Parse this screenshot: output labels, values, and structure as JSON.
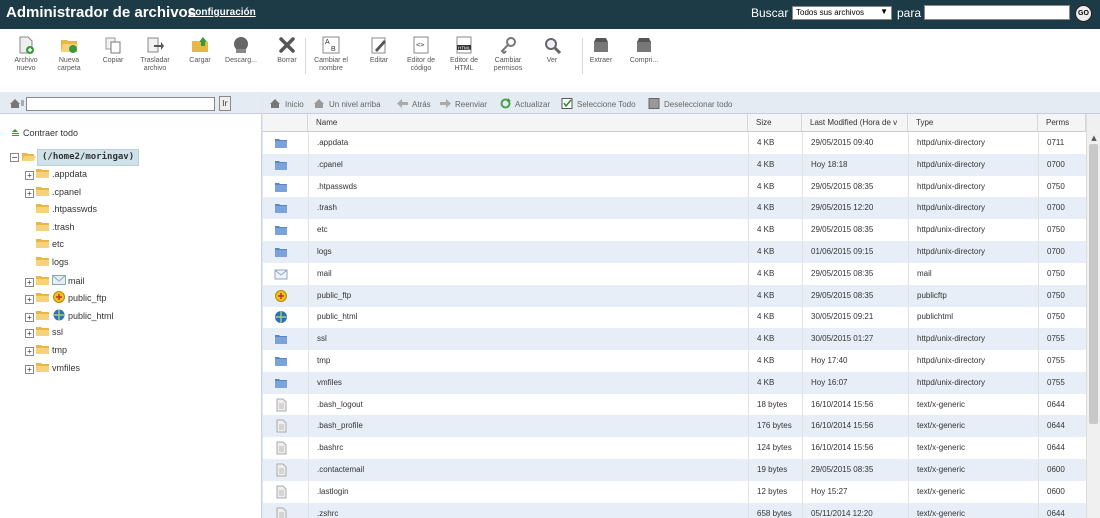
{
  "header": {
    "title": "Administrador de archivos",
    "config_link": "Configuración",
    "search_label": "Buscar",
    "search_scope": "Todos sus archivos",
    "para_label": "para",
    "search_value": "",
    "go_label": "GO"
  },
  "toolbar": {
    "items": [
      {
        "label": "Archivo nuevo",
        "icon": "new-file-icon"
      },
      {
        "label": "Nueva carpeta",
        "icon": "new-folder-icon"
      },
      {
        "label": "Copiar",
        "icon": "copy-icon"
      },
      {
        "label": "Trasladar archivo",
        "icon": "move-icon"
      },
      {
        "label": "Cargar",
        "icon": "upload-icon"
      },
      {
        "label": "Descarg...",
        "icon": "download-icon"
      },
      {
        "label": "Borrar",
        "icon": "delete-icon"
      },
      {
        "label": "Cambiar el nombre",
        "icon": "rename-icon"
      },
      {
        "label": "Editar",
        "icon": "edit-icon"
      },
      {
        "label": "Editor de código",
        "icon": "code-editor-icon"
      },
      {
        "label": "Editor de HTML",
        "icon": "html-editor-icon"
      },
      {
        "label": "Cambiar permisos",
        "icon": "permissions-icon"
      },
      {
        "label": "Ver",
        "icon": "view-icon"
      },
      {
        "label": "Extraer",
        "icon": "extract-icon"
      },
      {
        "label": "Compri...",
        "icon": "compress-icon"
      }
    ]
  },
  "sidebar": {
    "path_value": "",
    "path_go": "Ir",
    "collapse_all": "Contraer todo",
    "root": "(/home2/moringav)",
    "tree": [
      {
        "name": ".appdata",
        "expandable": true,
        "icon": "folder-icon"
      },
      {
        "name": ".cpanel",
        "expandable": true,
        "icon": "folder-icon"
      },
      {
        "name": ".htpasswds",
        "expandable": false,
        "icon": "folder-icon"
      },
      {
        "name": ".trash",
        "expandable": false,
        "icon": "folder-icon"
      },
      {
        "name": "etc",
        "expandable": false,
        "icon": "folder-icon"
      },
      {
        "name": "logs",
        "expandable": false,
        "icon": "folder-icon"
      },
      {
        "name": "mail",
        "expandable": true,
        "icon": "mail-folder-icon"
      },
      {
        "name": "public_ftp",
        "expandable": true,
        "icon": "ftp-folder-icon"
      },
      {
        "name": "public_html",
        "expandable": true,
        "icon": "globe-folder-icon"
      },
      {
        "name": "ssl",
        "expandable": true,
        "icon": "folder-icon"
      },
      {
        "name": "tmp",
        "expandable": true,
        "icon": "folder-icon"
      },
      {
        "name": "vmfiles",
        "expandable": true,
        "icon": "folder-icon"
      }
    ]
  },
  "nav": {
    "home": "Inicio",
    "up": "Un nivel arriba",
    "back": "Atrás",
    "forward": "Reenviar",
    "reload": "Actualizar",
    "select_all": "Seleccione Todo",
    "deselect_all": "Deseleccionar todo"
  },
  "files": {
    "columns": [
      "Name",
      "Size",
      "Last Modified (Hora de v",
      "Type",
      "Perms"
    ],
    "rows": [
      {
        "name": ".appdata",
        "size": "4 KB",
        "modified": "29/05/2015 09:40",
        "type": "httpd/unix-directory",
        "perms": "0711",
        "icon": "folder-icon"
      },
      {
        "name": ".cpanel",
        "size": "4 KB",
        "modified": "Hoy 18:18",
        "type": "httpd/unix-directory",
        "perms": "0700",
        "icon": "folder-icon"
      },
      {
        "name": ".htpasswds",
        "size": "4 KB",
        "modified": "29/05/2015 08:35",
        "type": "httpd/unix-directory",
        "perms": "0750",
        "icon": "folder-icon"
      },
      {
        "name": ".trash",
        "size": "4 KB",
        "modified": "29/05/2015 12:20",
        "type": "httpd/unix-directory",
        "perms": "0700",
        "icon": "folder-icon"
      },
      {
        "name": "etc",
        "size": "4 KB",
        "modified": "29/05/2015 08:35",
        "type": "httpd/unix-directory",
        "perms": "0750",
        "icon": "folder-icon"
      },
      {
        "name": "logs",
        "size": "4 KB",
        "modified": "01/06/2015 09:15",
        "type": "httpd/unix-directory",
        "perms": "0700",
        "icon": "folder-icon"
      },
      {
        "name": "mail",
        "size": "4 KB",
        "modified": "29/05/2015 08:35",
        "type": "mail",
        "perms": "0750",
        "icon": "mail-icon"
      },
      {
        "name": "public_ftp",
        "size": "4 KB",
        "modified": "29/05/2015 08:35",
        "type": "publicftp",
        "perms": "0750",
        "icon": "ftp-icon"
      },
      {
        "name": "public_html",
        "size": "4 KB",
        "modified": "30/05/2015 09:21",
        "type": "publichtml",
        "perms": "0750",
        "icon": "globe-icon"
      },
      {
        "name": "ssl",
        "size": "4 KB",
        "modified": "30/05/2015 01:27",
        "type": "httpd/unix-directory",
        "perms": "0755",
        "icon": "folder-icon"
      },
      {
        "name": "tmp",
        "size": "4 KB",
        "modified": "Hoy 17:40",
        "type": "httpd/unix-directory",
        "perms": "0755",
        "icon": "folder-icon"
      },
      {
        "name": "vmfiles",
        "size": "4 KB",
        "modified": "Hoy 16:07",
        "type": "httpd/unix-directory",
        "perms": "0755",
        "icon": "folder-icon"
      },
      {
        "name": ".bash_logout",
        "size": "18 bytes",
        "modified": "16/10/2014 15:56",
        "type": "text/x-generic",
        "perms": "0644",
        "icon": "file-icon"
      },
      {
        "name": ".bash_profile",
        "size": "176 bytes",
        "modified": "16/10/2014 15:56",
        "type": "text/x-generic",
        "perms": "0644",
        "icon": "file-icon"
      },
      {
        "name": ".bashrc",
        "size": "124 bytes",
        "modified": "16/10/2014 15:56",
        "type": "text/x-generic",
        "perms": "0644",
        "icon": "file-icon"
      },
      {
        "name": ".contactemail",
        "size": "19 bytes",
        "modified": "29/05/2015 08:35",
        "type": "text/x-generic",
        "perms": "0600",
        "icon": "file-icon"
      },
      {
        "name": ".lastlogin",
        "size": "12 bytes",
        "modified": "Hoy 15:27",
        "type": "text/x-generic",
        "perms": "0600",
        "icon": "file-icon"
      },
      {
        "name": ".zshrc",
        "size": "658 bytes",
        "modified": "05/11/2014 12:20",
        "type": "text/x-generic",
        "perms": "0644",
        "icon": "file-icon"
      }
    ]
  }
}
